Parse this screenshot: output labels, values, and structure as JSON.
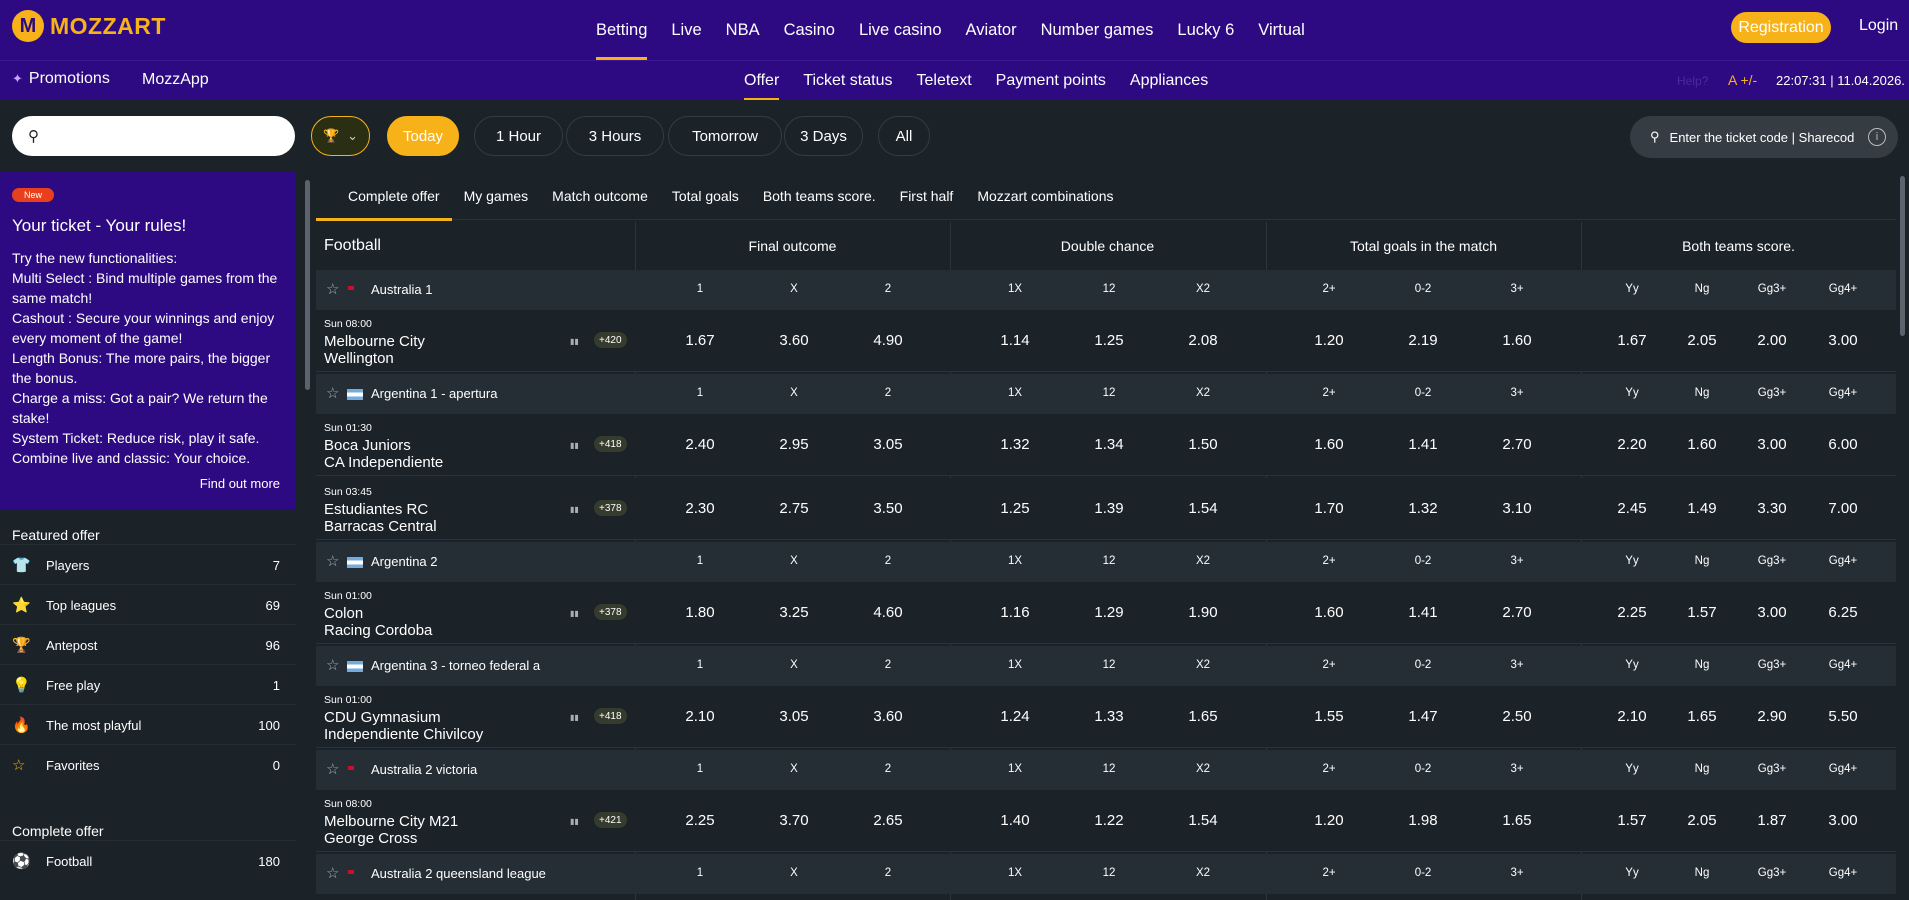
{
  "brand": {
    "name": "MOZZART",
    "mark": "M"
  },
  "main_nav": [
    "Betting",
    "Live",
    "NBA",
    "Casino",
    "Live casino",
    "Aviator",
    "Number games",
    "Lucky 6",
    "Virtual"
  ],
  "registration_label": "Registration",
  "login_label": "Login",
  "sub_nav_left": {
    "promotions": "Promotions",
    "mozzapp": "MozzApp"
  },
  "sub_nav": [
    "Offer",
    "Ticket status",
    "Teletext",
    "Payment points",
    "Appliances"
  ],
  "help": "Help?",
  "font_size": "A +/-",
  "clock": "22:07:31 | 11.04.2026.",
  "time_filters": [
    "Today",
    "1 Hour",
    "3 Hours",
    "Tomorrow",
    "3 Days",
    "All"
  ],
  "ticket_placeholder": "Enter the ticket code | Sharecod",
  "promo": {
    "badge": "New",
    "title": "Your ticket - Your rules!",
    "lines": [
      "Try the new functionalities:",
      "Multi Select : Bind multiple games from the same match!",
      "Cashout : Secure your winnings and enjoy every moment of the game!",
      "Length Bonus: The more pairs, the bigger the bonus.",
      "Charge a miss: Got a pair? We return the stake!",
      "System Ticket: Reduce risk, play it safe.",
      "Combine live and classic: Your choice."
    ],
    "find_out_more": "Find out more"
  },
  "featured_title": "Featured offer",
  "featured": [
    {
      "icon": "jersey-icon",
      "label": "Players",
      "count": "7"
    },
    {
      "icon": "star-badge-icon",
      "label": "Top leagues",
      "count": "69"
    },
    {
      "icon": "trophy-icon",
      "label": "Antepost",
      "count": "96"
    },
    {
      "icon": "lightbulb-icon",
      "label": "Free play",
      "count": "1"
    },
    {
      "icon": "flame-icon",
      "label": "The most playful",
      "count": "100"
    },
    {
      "icon": "star-outline-icon",
      "label": "Favorites",
      "count": "0"
    }
  ],
  "complete_title": "Complete offer",
  "complete": [
    {
      "icon": "football-icon",
      "label": "Football",
      "count": "180"
    }
  ],
  "tabs": [
    "Complete offer",
    "My games",
    "Match outcome",
    "Total goals",
    "Both teams score.",
    "First half",
    "Mozzart combinations"
  ],
  "sport": "Football",
  "market_groups": [
    "Final outcome",
    "Double chance",
    "Total goals in the match",
    "Both teams score."
  ],
  "odds_headers": [
    "1",
    "X",
    "2",
    "1X",
    "12",
    "X2",
    "2+",
    "0-2",
    "3+",
    "Yy",
    "Ng",
    "Gg3+",
    "Gg4+"
  ],
  "leagues": [
    {
      "name": "Australia 1",
      "flag": "au",
      "matches": [
        {
          "time": "Sun 08:00",
          "home": "Melbourne City",
          "away": "Wellington",
          "more": "+420",
          "odds": [
            "1.67",
            "3.60",
            "4.90",
            "1.14",
            "1.25",
            "2.08",
            "1.20",
            "2.19",
            "1.60",
            "1.67",
            "2.05",
            "2.00",
            "3.00"
          ]
        }
      ]
    },
    {
      "name": "Argentina 1 - apertura",
      "flag": "ar",
      "matches": [
        {
          "time": "Sun 01:30",
          "home": "Boca Juniors",
          "away": "CA Independiente",
          "more": "+418",
          "odds": [
            "2.40",
            "2.95",
            "3.05",
            "1.32",
            "1.34",
            "1.50",
            "1.60",
            "1.41",
            "2.70",
            "2.20",
            "1.60",
            "3.00",
            "6.00"
          ]
        },
        {
          "time": "Sun 03:45",
          "home": "Estudiantes RC",
          "away": "Barracas Central",
          "more": "+378",
          "odds": [
            "2.30",
            "2.75",
            "3.50",
            "1.25",
            "1.39",
            "1.54",
            "1.70",
            "1.32",
            "3.10",
            "2.45",
            "1.49",
            "3.30",
            "7.00"
          ]
        }
      ]
    },
    {
      "name": "Argentina 2",
      "flag": "ar",
      "matches": [
        {
          "time": "Sun 01:00",
          "home": "Colon",
          "away": "Racing Cordoba",
          "more": "+378",
          "odds": [
            "1.80",
            "3.25",
            "4.60",
            "1.16",
            "1.29",
            "1.90",
            "1.60",
            "1.41",
            "2.70",
            "2.25",
            "1.57",
            "3.00",
            "6.25"
          ]
        }
      ]
    },
    {
      "name": "Argentina 3 - torneo federal a",
      "flag": "ar",
      "matches": [
        {
          "time": "Sun 01:00",
          "home": "CDU Gymnasium",
          "away": "Independiente Chivilcoy",
          "more": "+418",
          "odds": [
            "2.10",
            "3.05",
            "3.60",
            "1.24",
            "1.33",
            "1.65",
            "1.55",
            "1.47",
            "2.50",
            "2.10",
            "1.65",
            "2.90",
            "5.50"
          ]
        }
      ]
    },
    {
      "name": "Australia 2 victoria",
      "flag": "au",
      "matches": [
        {
          "time": "Sun 08:00",
          "home": "Melbourne City M21",
          "away": "George Cross",
          "more": "+421",
          "odds": [
            "2.25",
            "3.70",
            "2.65",
            "1.40",
            "1.22",
            "1.54",
            "1.20",
            "1.98",
            "1.65",
            "1.57",
            "2.05",
            "1.87",
            "3.00"
          ]
        }
      ]
    },
    {
      "name": "Australia 2 queensland league",
      "flag": "au",
      "matches": []
    }
  ]
}
